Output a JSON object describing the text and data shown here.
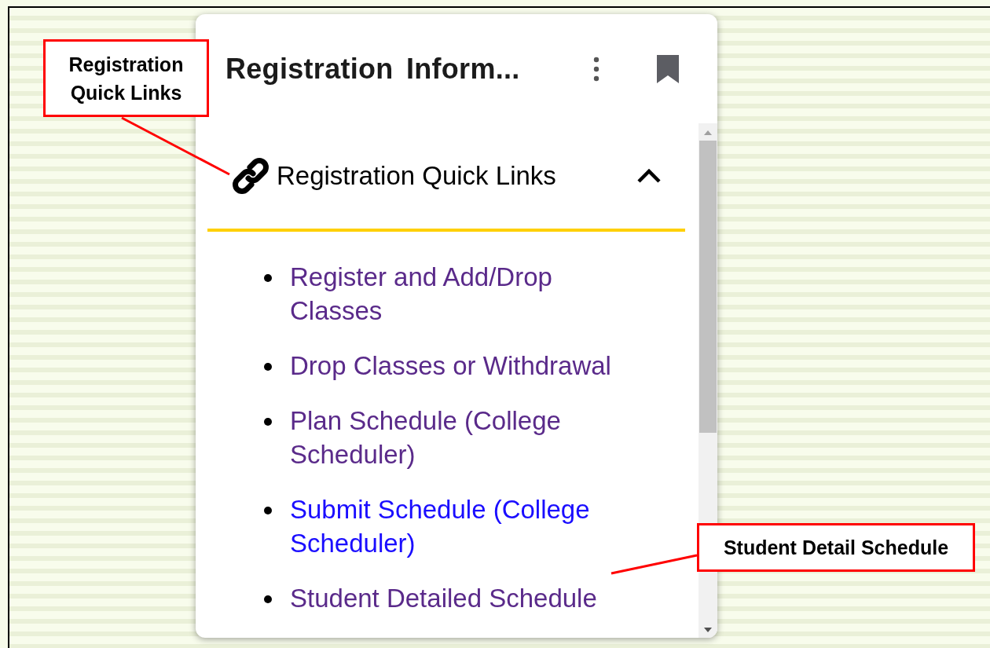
{
  "card": {
    "title": "Registration Inform...",
    "section": {
      "title": "Registration Quick Links",
      "expanded": true,
      "links": [
        {
          "label": "Register and Add/Drop Classes",
          "visited": true
        },
        {
          "label": "Drop Classes or Withdrawal",
          "visited": true
        },
        {
          "label": "Plan Schedule (College Scheduler)",
          "visited": true
        },
        {
          "label": "Submit Schedule (College Scheduler)",
          "visited": false
        },
        {
          "label": "Student Detailed Schedule",
          "visited": true
        }
      ]
    }
  },
  "callouts": [
    {
      "text": "Registration Quick Links"
    },
    {
      "text": "Student Detail Schedule"
    }
  ]
}
